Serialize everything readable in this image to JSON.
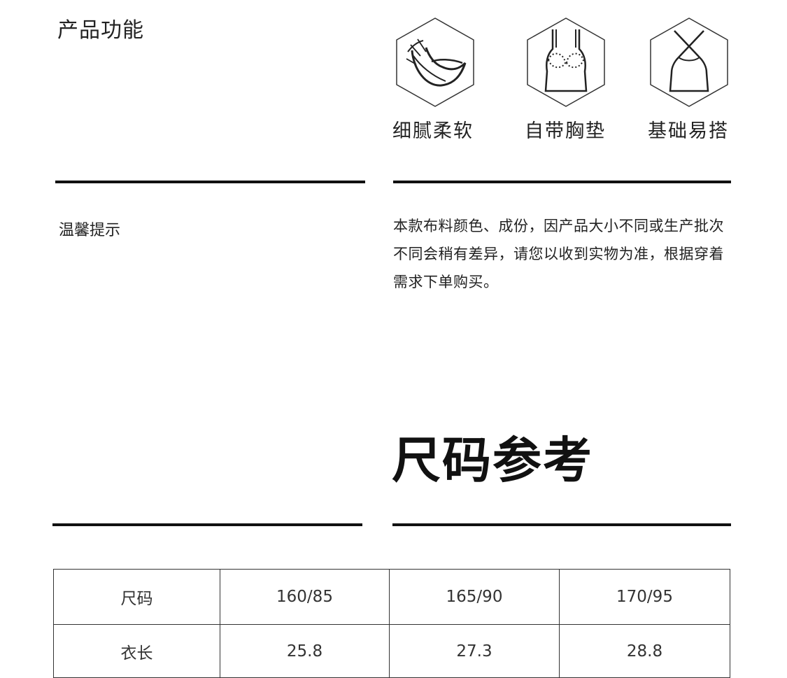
{
  "features": {
    "title": "产品功能",
    "items": [
      {
        "icon": "feather-icon",
        "label": "细腻柔软"
      },
      {
        "icon": "padded-camisole-icon",
        "label": "自带胸垫"
      },
      {
        "icon": "cross-strap-camisole-icon",
        "label": "基础易搭"
      }
    ]
  },
  "notice": {
    "title": "温馨提示",
    "body": "本款布料颜色、成份，因产品大小不同或生产批次不同会稍有差异，请您以收到实物为准，根据穿着需求下单购买。"
  },
  "size_ref": {
    "title": "尺码参考",
    "header": [
      "尺码",
      "160/85",
      "165/90",
      "170/95"
    ],
    "rows": [
      [
        "衣长",
        "25.8",
        "27.3",
        "28.8"
      ]
    ]
  }
}
